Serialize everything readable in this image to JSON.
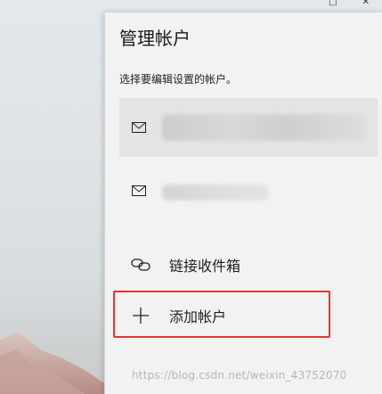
{
  "panel": {
    "title": "管理帐户",
    "description": "选择要编辑设置的帐户。",
    "accounts": [
      {
        "icon": "mail-icon",
        "selected": true
      },
      {
        "icon": "mail-icon",
        "selected": false
      }
    ],
    "menu": [
      {
        "icon": "link-icon",
        "label": "链接收件箱"
      },
      {
        "icon": "plus-icon",
        "label": "添加帐户"
      }
    ]
  },
  "watermark": "https://blog.csdn.net/weixin_43752070",
  "colors": {
    "panel_bg": "#f2f2f2",
    "selected_bg": "#e4e4e4",
    "highlight": "#e0382f"
  }
}
